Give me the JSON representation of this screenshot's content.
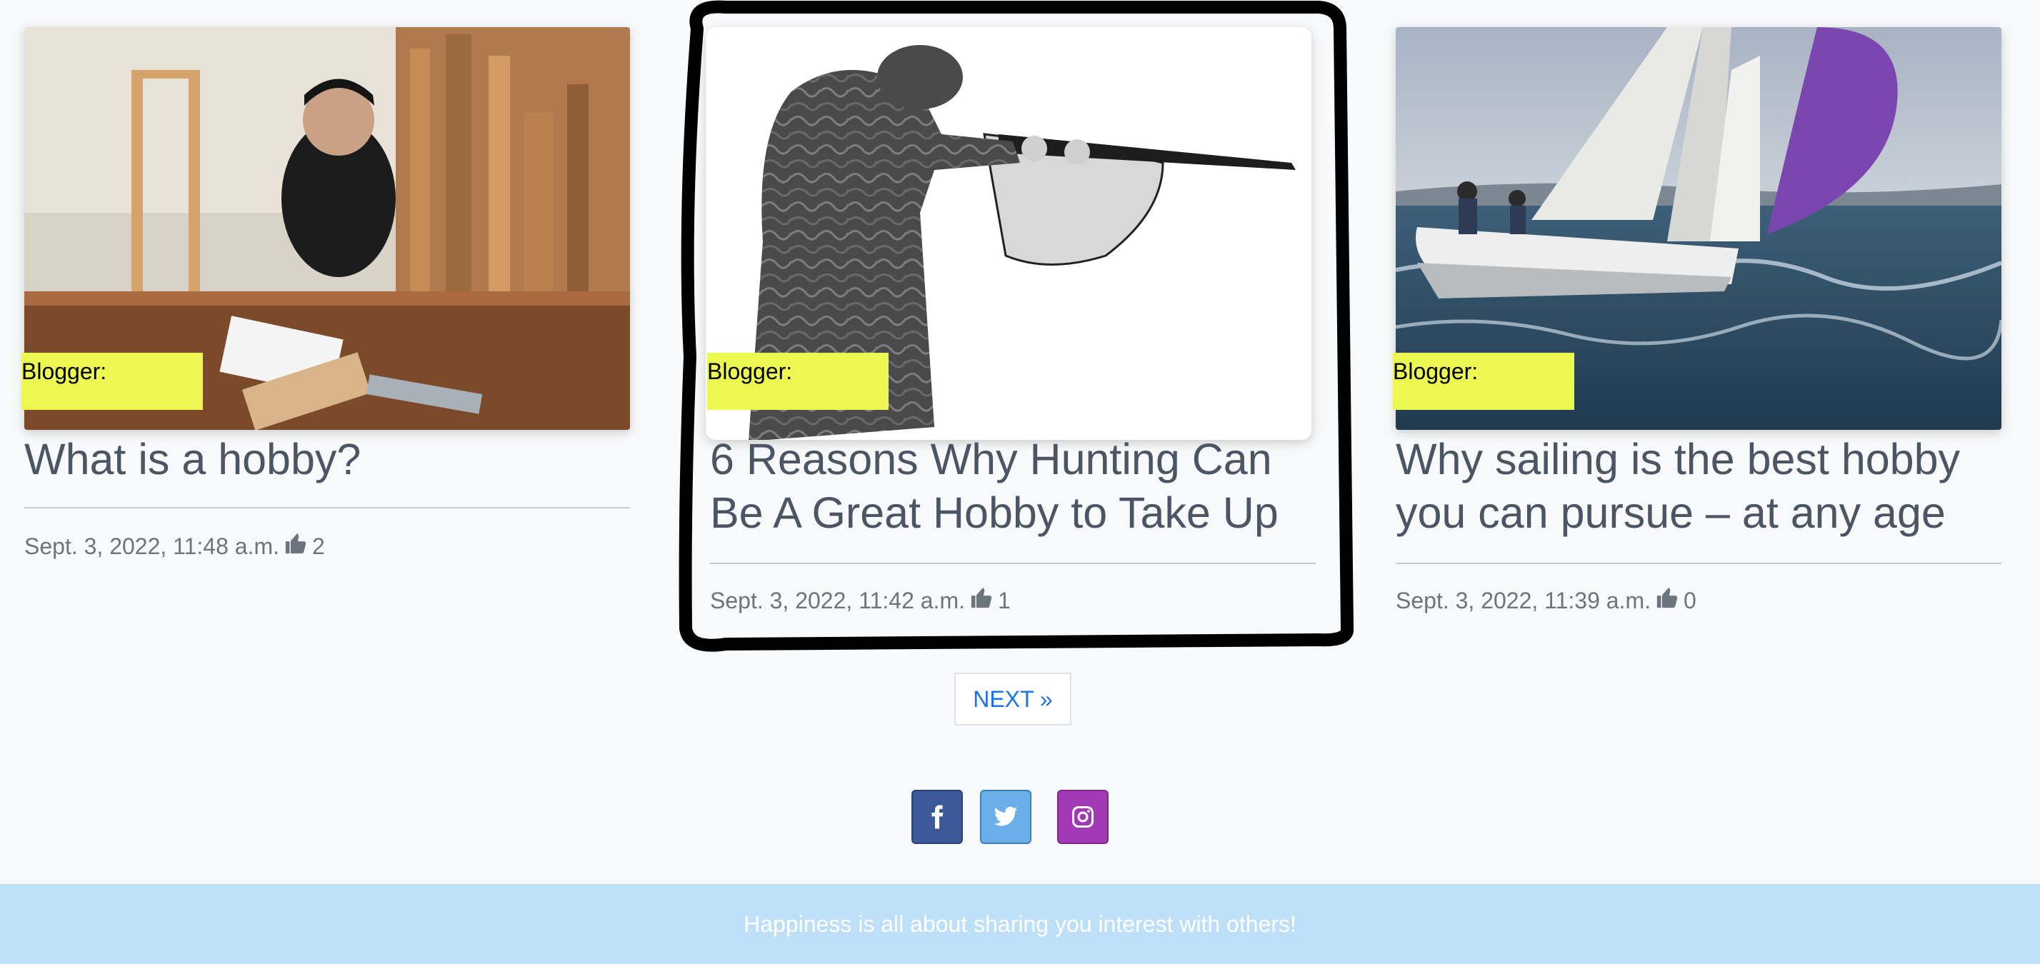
{
  "posts": [
    {
      "image_alt": "man drafting in woodworking shop",
      "blogger_label": "Blogger:",
      "title": "What is a hobby?",
      "date": "Sept. 3, 2022, 11:48 a.m.",
      "likes": "2"
    },
    {
      "image_alt": "hunter aiming shotgun",
      "blogger_label": "Blogger:",
      "title": "6 Reasons Why Hunting Can Be A Great Hobby to Take Up",
      "date": "Sept. 3, 2022, 11:42 a.m.",
      "likes": "1"
    },
    {
      "image_alt": "sailboats racing on the sea",
      "blogger_label": "Blogger:",
      "title": "Why sailing is the best hobby you can pursue – at any age",
      "date": "Sept. 3, 2022, 11:39 a.m.",
      "likes": "0"
    }
  ],
  "pagination": {
    "next_label": "NEXT »"
  },
  "social": [
    {
      "icon": "facebook-icon",
      "color": "#3b5998"
    },
    {
      "icon": "twitter-icon",
      "color": "#6aaeea"
    },
    {
      "icon": "instagram-icon",
      "color": "#a23ab5"
    }
  ],
  "footer": {
    "text": "Happiness is all about sharing you interest with others!"
  },
  "colors": {
    "blogger_bg": "#ecf751",
    "footer_bg": "#bde0f8",
    "link": "#1a73e8"
  }
}
